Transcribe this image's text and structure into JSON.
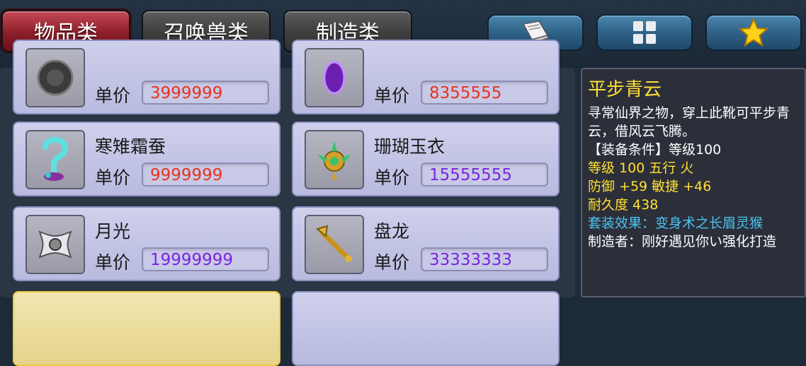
{
  "tabs": [
    {
      "label": "物品类",
      "active": true
    },
    {
      "label": "召唤兽类",
      "active": false
    },
    {
      "label": "制造类",
      "active": false
    }
  ],
  "tool_buttons": [
    {
      "icon": "book-icon"
    },
    {
      "icon": "grid-icon"
    },
    {
      "icon": "star-icon"
    }
  ],
  "items": [
    {
      "name": "",
      "price_label": "单价",
      "price": "3999999",
      "price_color": "#e8321f"
    },
    {
      "name": "",
      "price_label": "单价",
      "price": "8355555",
      "price_color": "#e8321f"
    },
    {
      "name": "寒雉霜蚕",
      "price_label": "单价",
      "price": "9999999",
      "price_color": "#e8321f"
    },
    {
      "name": "珊瑚玉衣",
      "price_label": "单价",
      "price": "15555555",
      "price_color": "#7a24e0"
    },
    {
      "name": "月光",
      "price_label": "单价",
      "price": "19999999",
      "price_color": "#7a24e0"
    },
    {
      "name": "盘龙",
      "price_label": "单价",
      "price": "33333333",
      "price_color": "#7a24e0"
    }
  ],
  "detail": {
    "title": "平步青云",
    "desc": "寻常仙界之物，穿上此靴可平步青云，借风云飞腾。",
    "requirement": "【装备条件】等级100",
    "level_element": "等级 100  五行 火",
    "stats": "防御 +59 敏捷 +46",
    "durability": "耐久度 438",
    "set_effect": "套装效果：变身术之长眉灵猴",
    "maker": "制造者：刚好遇见你い强化打造"
  }
}
